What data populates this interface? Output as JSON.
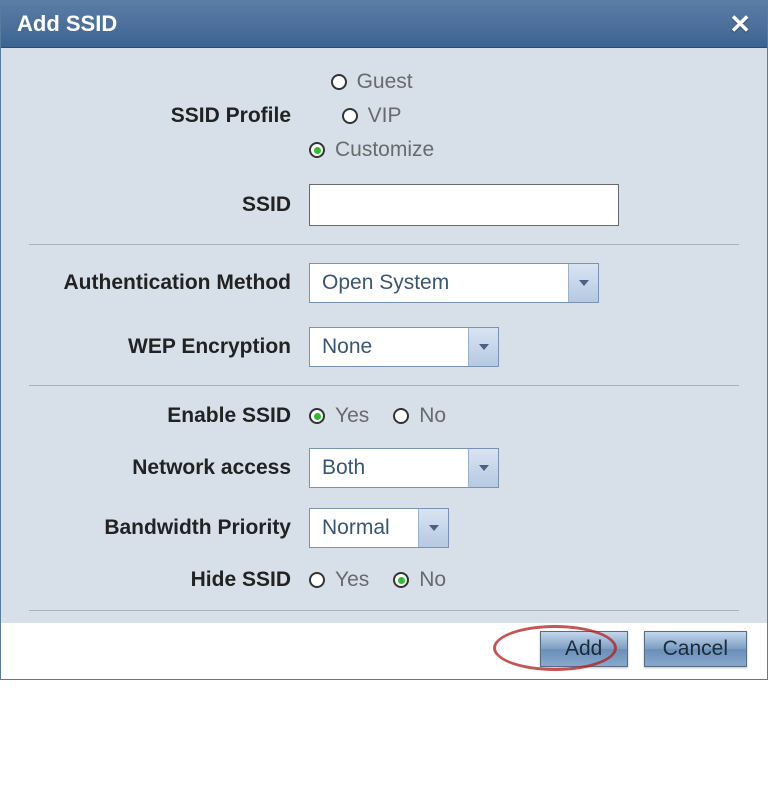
{
  "title": "Add SSID",
  "labels": {
    "ssid_profile": "SSID Profile",
    "ssid": "SSID",
    "auth_method": "Authentication Method",
    "wep_enc": "WEP Encryption",
    "enable_ssid": "Enable SSID",
    "network_access": "Network access",
    "bandwidth_priority": "Bandwidth Priority",
    "hide_ssid": "Hide SSID"
  },
  "profile": {
    "options": [
      "Guest",
      "VIP",
      "Customize"
    ],
    "selected": "Customize"
  },
  "ssid_value": "",
  "auth_method": {
    "value": "Open System"
  },
  "wep_enc": {
    "value": "None"
  },
  "enable_ssid": {
    "options": [
      "Yes",
      "No"
    ],
    "selected": "Yes"
  },
  "network_access": {
    "value": "Both"
  },
  "bandwidth_priority": {
    "value": "Normal"
  },
  "hide_ssid": {
    "options": [
      "Yes",
      "No"
    ],
    "selected": "No"
  },
  "buttons": {
    "add": "Add",
    "cancel": "Cancel"
  }
}
